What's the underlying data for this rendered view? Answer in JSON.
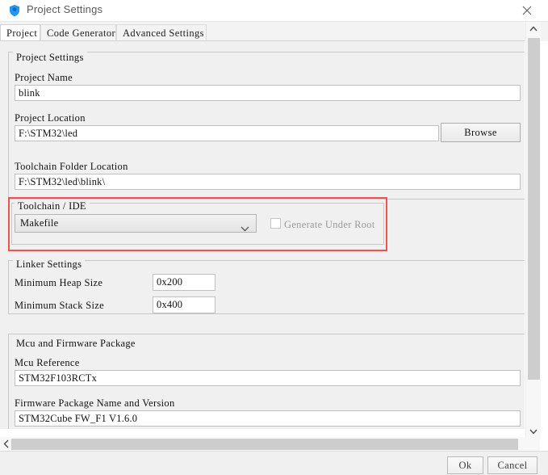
{
  "window": {
    "title": "Project Settings",
    "icon": "shield-icon",
    "close_label": "close-icon"
  },
  "tabs": [
    {
      "label": "Project",
      "active": true
    },
    {
      "label": "Code Generator",
      "active": false
    },
    {
      "label": "Advanced Settings",
      "active": false
    }
  ],
  "project_settings": {
    "group_title": "Project Settings",
    "project_name_label": "Project Name",
    "project_name_value": "blink",
    "project_location_label": "Project Location",
    "project_location_value": "F:\\STM32\\led",
    "browse_label": "Browse",
    "toolchain_folder_label": "Toolchain Folder Location",
    "toolchain_folder_value": "F:\\STM32\\led\\blink\\"
  },
  "toolchain": {
    "group_title": "Toolchain / IDE",
    "selected": "Makefile",
    "generate_under_root_label": "Generate Under Root",
    "generate_under_root_checked": false,
    "generate_under_root_disabled": true,
    "highlight_color": "#ef5350"
  },
  "linker": {
    "group_title": "Linker Settings",
    "heap_label": "Minimum Heap Size",
    "heap_value": "0x200",
    "stack_label": "Minimum Stack Size",
    "stack_value": "0x400"
  },
  "mcu": {
    "group_title": "Mcu and Firmware Package",
    "mcu_reference_label": "Mcu Reference",
    "mcu_reference_value": "STM32F103RCTx",
    "firmware_label": "Firmware Package Name and Version",
    "firmware_value": "STM32Cube FW_F1 V1.6.0"
  },
  "footer": {
    "ok_label": "Ok",
    "cancel_label": "Cancel"
  },
  "scrollbars": {
    "v_up": "chevron-up-icon",
    "v_down": "chevron-down-icon",
    "h_left": "chevron-left-icon",
    "h_right": "chevron-right-icon"
  }
}
